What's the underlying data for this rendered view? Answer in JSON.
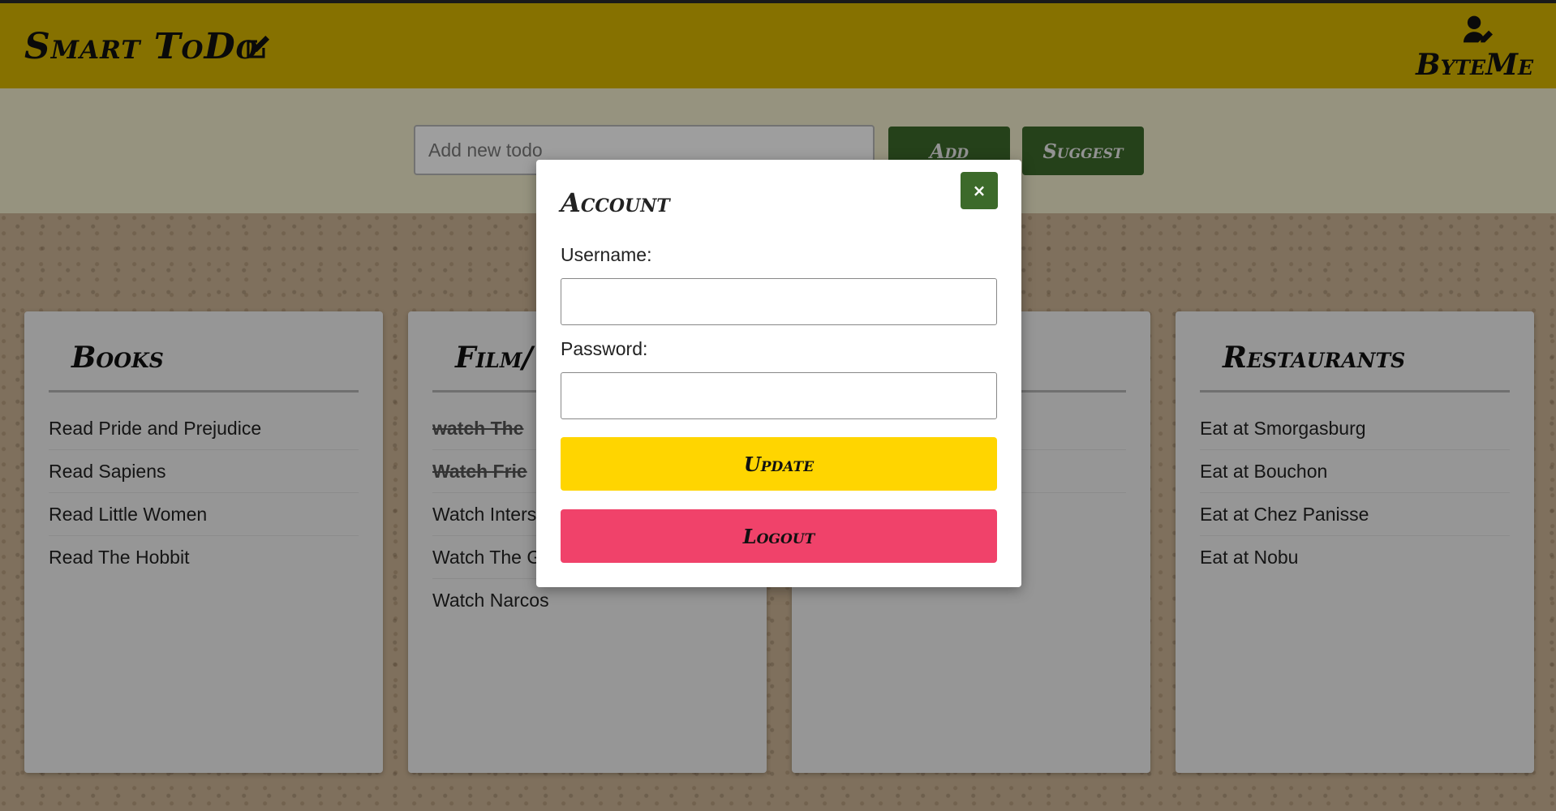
{
  "header": {
    "brand": "Smart ToDo",
    "brand_icon": "edit-icon",
    "user_icon": "user-edit-icon",
    "user_name": "ByteMe"
  },
  "todo_form": {
    "placeholder": "Add new todo",
    "add_label": "Add",
    "suggest_label": "Suggest"
  },
  "cards": [
    {
      "title": "Books",
      "items": [
        {
          "text": "Read Pride and Prejudice",
          "done": false
        },
        {
          "text": "Read Sapiens",
          "done": false
        },
        {
          "text": "Read Little Women",
          "done": false
        },
        {
          "text": "Read The Hobbit",
          "done": false
        }
      ]
    },
    {
      "title": "Film/",
      "items": [
        {
          "text": "watch The",
          "done": true
        },
        {
          "text": "Watch Frie",
          "done": true
        },
        {
          "text": "Watch Inters",
          "done": false
        },
        {
          "text": "Watch The G",
          "done": false
        },
        {
          "text": "Watch Narcos",
          "done": false
        }
      ]
    },
    {
      "title": "",
      "items": [
        {
          "text": "",
          "done": false
        },
        {
          "text": "",
          "done": false
        },
        {
          "text": "",
          "done": false
        }
      ]
    },
    {
      "title": "Restaurants",
      "items": [
        {
          "text": "Eat at Smorgasburg",
          "done": false
        },
        {
          "text": "Eat at Bouchon",
          "done": false
        },
        {
          "text": "Eat at Chez Panisse",
          "done": false
        },
        {
          "text": "Eat at Nobu",
          "done": false
        }
      ]
    }
  ],
  "modal": {
    "title": "Account",
    "close_label": "×",
    "username_label": "Username:",
    "username_value": "",
    "password_label": "Password:",
    "password_value": "",
    "update_label": "Update",
    "logout_label": "Logout"
  },
  "colors": {
    "navbar": "#d9b700",
    "accent_green": "#3c6a2a",
    "update_yellow": "#ffd500",
    "logout_pink": "#f0426a"
  }
}
